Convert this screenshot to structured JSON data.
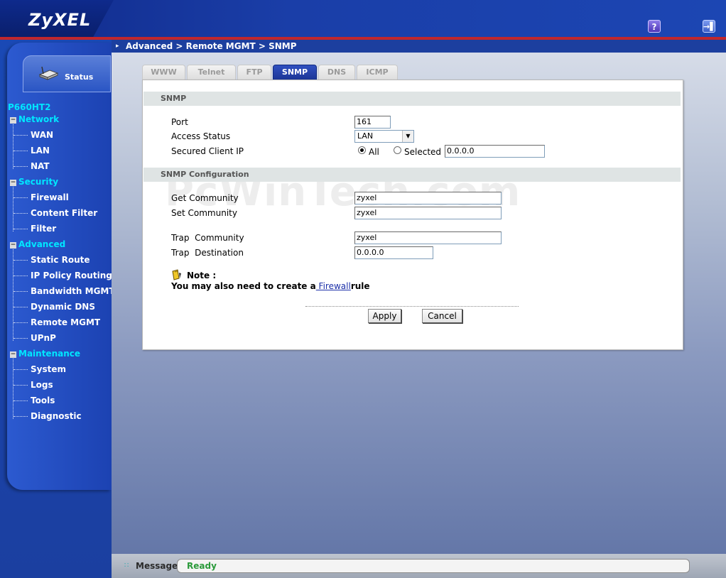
{
  "header": {
    "logo": "ZyXEL",
    "help_icon": "?",
    "logout_icon": "→▌"
  },
  "sidebar": {
    "status_label": "Status",
    "model": "P660HT2",
    "categories": [
      {
        "label": "Network",
        "toggle": "−",
        "items": [
          "WAN",
          "LAN",
          "NAT"
        ]
      },
      {
        "label": "Security",
        "toggle": "−",
        "items": [
          "Firewall",
          "Content Filter",
          "Filter"
        ]
      },
      {
        "label": "Advanced",
        "toggle": "−",
        "items": [
          "Static Route",
          "IP Policy Routing",
          "Bandwidth MGMT",
          "Dynamic DNS",
          "Remote MGMT",
          "UPnP"
        ]
      },
      {
        "label": "Maintenance",
        "toggle": "−",
        "items": [
          "System",
          "Logs",
          "Tools",
          "Diagnostic"
        ]
      }
    ]
  },
  "breadcrumb": "Advanced > Remote MGMT > SNMP",
  "tabs": [
    {
      "label": "WWW",
      "active": false
    },
    {
      "label": "Telnet",
      "active": false
    },
    {
      "label": "FTP",
      "active": false
    },
    {
      "label": "SNMP",
      "active": true
    },
    {
      "label": "DNS",
      "active": false
    },
    {
      "label": "ICMP",
      "active": false
    }
  ],
  "snmp": {
    "section_title": "SNMP",
    "port_label": "Port",
    "port_value": "161",
    "access_status_label": "Access Status",
    "access_status_value": "LAN",
    "secured_client_ip_label": "Secured Client IP",
    "radio_all_label": "All",
    "radio_selected_label": "Selected",
    "radio_all_checked": true,
    "selected_ip_value": "0.0.0.0"
  },
  "snmp_config": {
    "section_title": "SNMP Configuration",
    "get_community_label": "Get Community",
    "get_community_value": "zyxel",
    "set_community_label": "Set Community",
    "set_community_value": "zyxel",
    "trap_community_label": "Trap  Community",
    "trap_community_value": "zyxel",
    "trap_destination_label": "Trap  Destination",
    "trap_destination_value": "0.0.0.0"
  },
  "note": {
    "title": "Note :",
    "text_before": "You may also need to create a",
    "link": " Firewall",
    "text_after": "rule"
  },
  "buttons": {
    "apply": "Apply",
    "cancel": "Cancel"
  },
  "watermark": "PcWinTech.com",
  "statusbar": {
    "label": "Message",
    "value": "Ready"
  },
  "colors": {
    "header_blue": "#1a3ea8",
    "accent_red": "#c0272d",
    "nav_cyan": "#00e6ff",
    "status_green": "#2a9a3a"
  }
}
